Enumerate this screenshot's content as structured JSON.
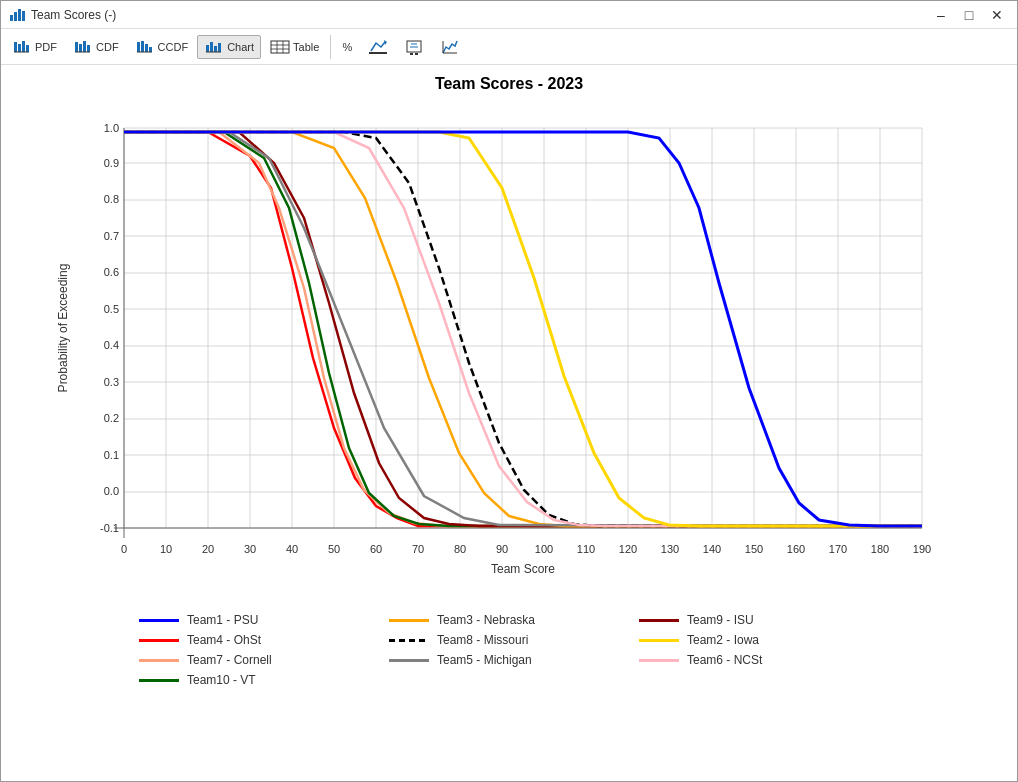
{
  "window": {
    "title": "Team Scores (-)",
    "title_icon": "chart-icon"
  },
  "toolbar": {
    "buttons": [
      {
        "label": "PDF",
        "icon": "pdf-icon",
        "active": false
      },
      {
        "label": "CDF",
        "icon": "cdf-icon",
        "active": false
      },
      {
        "label": "CCDF",
        "icon": "ccdf-icon",
        "active": false
      },
      {
        "label": "Chart",
        "icon": "chart-icon",
        "active": true
      },
      {
        "label": "Table",
        "icon": "table-icon",
        "active": false
      },
      {
        "label": "%",
        "icon": "percent-icon",
        "active": false
      }
    ]
  },
  "chart": {
    "title": "Team Scores - 2023",
    "x_label": "Team Score",
    "y_label": "Probability of Exceeding",
    "x_min": 0,
    "x_max": 190,
    "y_min": -0.1,
    "y_max": 1.0,
    "x_ticks": [
      0,
      10,
      20,
      30,
      40,
      50,
      60,
      70,
      80,
      90,
      100,
      110,
      120,
      130,
      140,
      150,
      160,
      170,
      180,
      190
    ],
    "y_ticks": [
      -0.1,
      0.0,
      0.1,
      0.2,
      0.3,
      0.4,
      0.5,
      0.6,
      0.7,
      0.8,
      0.9,
      1.0
    ]
  },
  "legend": {
    "items": [
      {
        "label": "Team1 - PSU",
        "color": "#0000FF"
      },
      {
        "label": "Team4 - OhSt",
        "color": "#FF0000"
      },
      {
        "label": "Team7 - Cornell",
        "color": "#FFA07A"
      },
      {
        "label": "Team10 - VT",
        "color": "#006400"
      },
      {
        "label": "Team3 - Nebraska",
        "color": "#FFA500"
      },
      {
        "label": "Team8 - Missouri",
        "color": "#000000"
      },
      {
        "label": "Team5 - Michigan",
        "color": "#808080"
      },
      {
        "label": "Team9 - ISU",
        "color": "#8B0000"
      },
      {
        "label": "Team2 - Iowa",
        "color": "#FFFF00"
      },
      {
        "label": "Team6 - NCSt",
        "color": "#FFB6C1"
      }
    ]
  }
}
